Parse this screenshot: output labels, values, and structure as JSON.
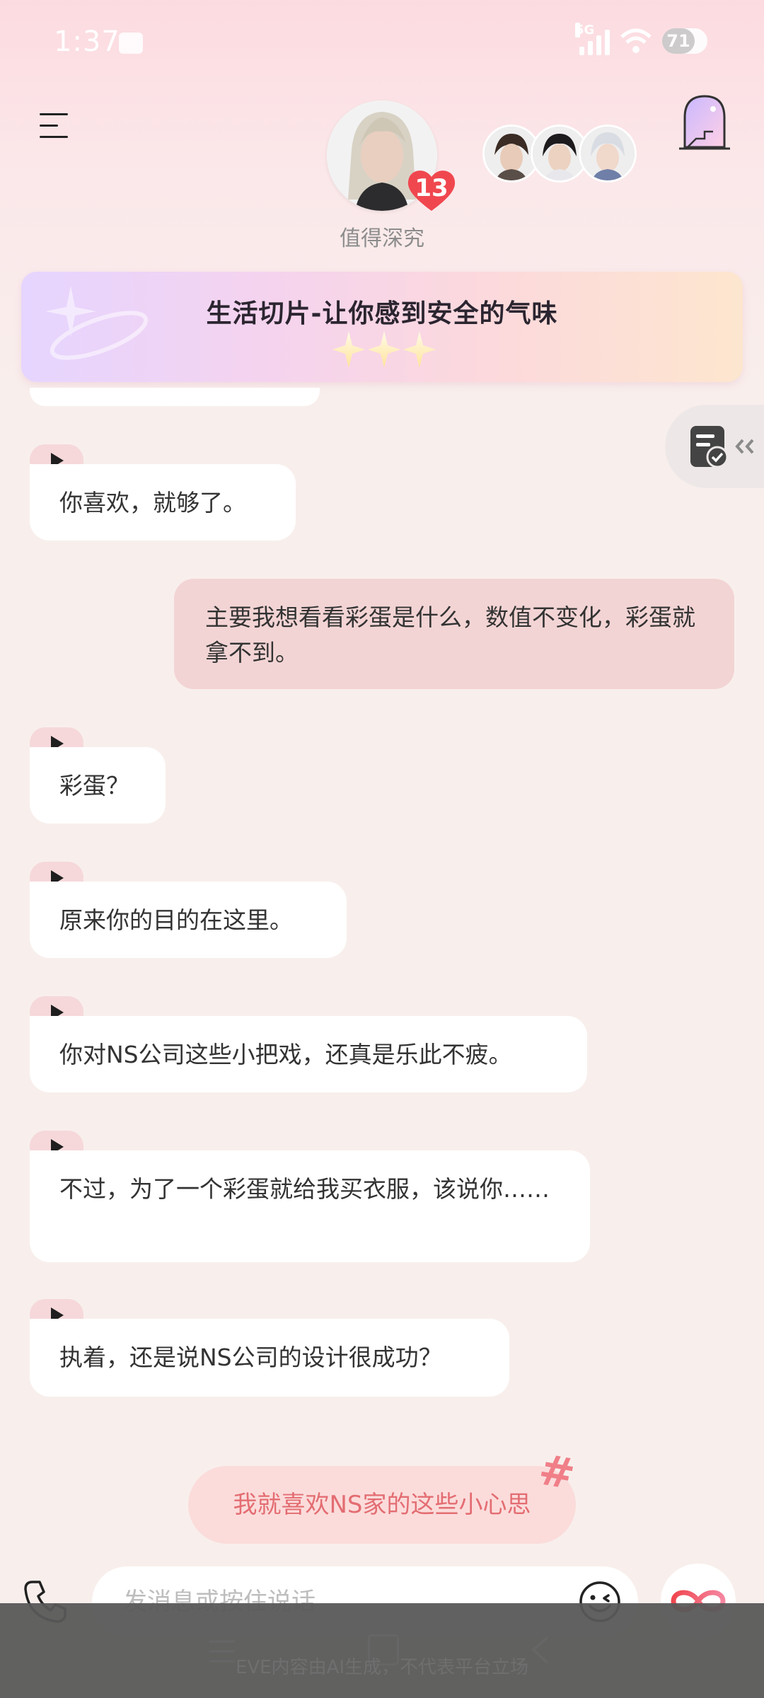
{
  "status_bar": {
    "time": "1:37",
    "network": "5G",
    "battery": "71"
  },
  "header": {
    "character_level": "13",
    "character_caption": "值得深究"
  },
  "banner": {
    "title": "生活切片-让你感到安全的气味"
  },
  "messages": [
    {
      "side": "left",
      "text": "你喜欢，就够了。"
    },
    {
      "side": "right",
      "text": "主要我想看看彩蛋是什么，数值不变化，彩蛋就拿不到。"
    },
    {
      "side": "left",
      "text": "彩蛋？"
    },
    {
      "side": "left",
      "text": "原来你的目的在这里。"
    },
    {
      "side": "left",
      "text": "你对NS公司这些小把戏，还真是乐此不疲。"
    },
    {
      "side": "left",
      "text": "不过，为了一个彩蛋就给我买衣服，该说你……"
    },
    {
      "side": "left",
      "text": "执着，还是说NS公司的设计很成功？"
    }
  ],
  "suggestion": {
    "text": "我就喜欢NS家的这些小心思",
    "tag": "#"
  },
  "input": {
    "placeholder": "发消息或按住说话"
  },
  "footer": {
    "disclaimer": "EVE内容由AI生成，不代表平台立场"
  },
  "colors": {
    "accent": "#e36d72",
    "user_bubble": "#f3d4d4",
    "bot_bubble": "#ffffff",
    "badge": "#f0474f"
  },
  "icons": [
    "menu-icon",
    "heart-badge-icon",
    "door-icon",
    "memo-check-icon",
    "play-icon",
    "phone-icon",
    "emoji-icon",
    "infinity-icon"
  ]
}
